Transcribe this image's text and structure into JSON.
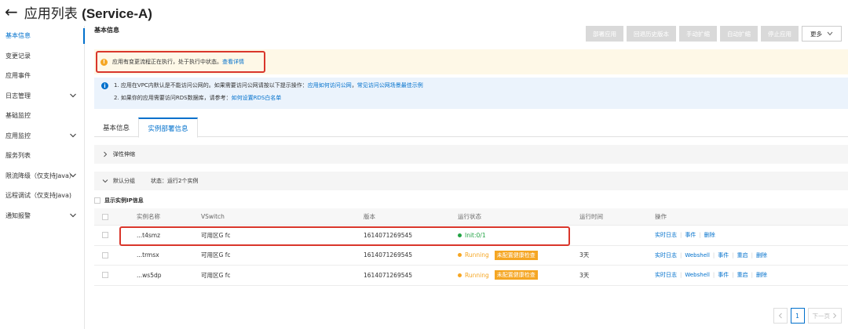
{
  "header": {
    "back_icon": "back-arrow-icon",
    "title_cn": "应用列表",
    "title_service": "(Service-A)"
  },
  "sidebar": {
    "items": [
      {
        "label": "基本信息",
        "active": true,
        "expandable": false
      },
      {
        "label": "变更记录",
        "active": false,
        "expandable": false
      },
      {
        "label": "应用事件",
        "active": false,
        "expandable": false
      },
      {
        "label": "日志管理",
        "active": false,
        "expandable": true
      },
      {
        "label": "基础监控",
        "active": false,
        "expandable": false
      },
      {
        "label": "应用监控",
        "active": false,
        "expandable": true
      },
      {
        "label": "服务列表",
        "active": false,
        "expandable": false
      },
      {
        "label": "限流降级（仅支持Java）",
        "active": false,
        "expandable": true
      },
      {
        "label": "远程调试（仅支持Java)",
        "active": false,
        "expandable": false
      },
      {
        "label": "通知报警",
        "active": false,
        "expandable": true
      }
    ]
  },
  "main": {
    "section_title": "基本信息",
    "toolbar": {
      "buttons": [
        "部署应用",
        "回退历史版本",
        "手动扩缩",
        "自动扩缩",
        "停止应用"
      ],
      "more_label": "更多"
    },
    "warning": {
      "text": "应用有变更流程正在执行，处于执行中状态。",
      "link": "查看详情"
    },
    "info": {
      "line1_text": "1. 应用在VPC内默认是不能访问公网的。如果需要访问公网请按以下提示操作：",
      "line1_link1": "应用如何访问公网",
      "line1_sep": "，",
      "line1_link2": "常见访问公网场景最佳示例",
      "line2_text": "2. 如果你的应用需要访问RDS数据库，请参考：",
      "line2_link": "如何设置RDS白名单"
    },
    "tabs": [
      {
        "label": "基本信息",
        "active": false
      },
      {
        "label": "实例部署信息",
        "active": true
      }
    ],
    "elastic_panel": "弹性伸缩",
    "group_panel": {
      "name": "默认分组",
      "status": "状态：运行2个实例"
    },
    "show_ip_label": "显示实例IP信息",
    "table": {
      "headers": {
        "name": "实例名称",
        "vswitch": "VSwitch",
        "version": "版本",
        "status": "运行状态",
        "runtime": "运行时间",
        "ops": "操作"
      },
      "rows": [
        {
          "name": "...t4smz",
          "vswitch": "可用区G fc",
          "version": "1614071269545",
          "status": "Init:0/1",
          "status_kind": "init",
          "badge": "",
          "runtime": "",
          "ops": [
            "实时日志",
            "事件",
            "删除"
          ]
        },
        {
          "name": "...trmsx",
          "vswitch": "可用区G fc",
          "version": "1614071269545",
          "status": "Running",
          "status_kind": "running",
          "badge": "未配置健康检查",
          "runtime": "3天",
          "ops": [
            "实时日志",
            "Webshell",
            "事件",
            "重启",
            "删除"
          ]
        },
        {
          "name": "...ws5dp",
          "vswitch": "可用区G fc",
          "version": "1614071269545",
          "status": "Running",
          "status_kind": "running",
          "badge": "未配置健康检查",
          "runtime": "3天",
          "ops": [
            "实时日志",
            "Webshell",
            "事件",
            "重启",
            "删除"
          ]
        }
      ]
    },
    "pager": {
      "current": "1",
      "next": "下一页"
    }
  },
  "colors": {
    "accent": "#0070cc",
    "warning": "#f5a623",
    "success": "#22a344",
    "highlight": "#d9362b"
  }
}
